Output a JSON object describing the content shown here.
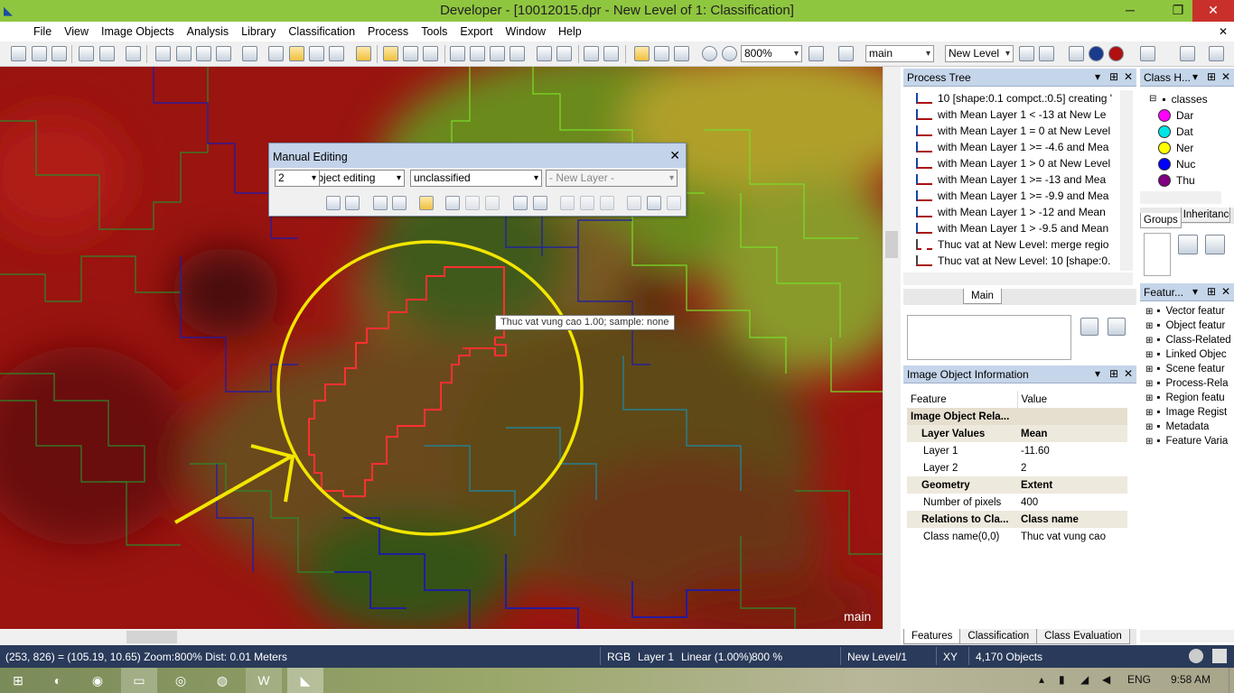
{
  "window": {
    "title": "Developer - [10012015.dpr - New Level of 1: Classification]",
    "minimize": "─",
    "restore": "❐",
    "close": "✕"
  },
  "menu": [
    "File",
    "View",
    "Image Objects",
    "Analysis",
    "Library",
    "Classification",
    "Process",
    "Tools",
    "Export",
    "Window",
    "Help"
  ],
  "toolbar": {
    "zoom": "800%",
    "view_combo": "main",
    "level_combo": "New Level"
  },
  "view": {
    "label": "main"
  },
  "manual_editing": {
    "title": "Manual Editing",
    "close": "✕",
    "mode": "Image object editing",
    "class": "unclassified",
    "layer": "- New Layer -",
    "brush": "2"
  },
  "tooltip": "Thuc vat vung cao 1.00;  sample: none",
  "process_tree": {
    "title": "Process Tree",
    "items": [
      "10 [shape:0.1 compct.:0.5] creating '",
      "with Mean Layer 1 < -13  at  New Le",
      "with Mean Layer 1 = 0  at  New Level",
      "with Mean Layer 1 >= -4.6  and Mea",
      "with Mean Layer 1 > 0  at  New Level",
      "with Mean Layer 1 >= -13  and Mea",
      "with Mean Layer 1 >= -9.9  and Mea",
      "with Mean Layer 1 > -12  and Mean",
      "with Mean Layer 1 > -9.5  and Mean",
      "Thuc vat at  New Level: merge regio",
      "Thuc vat at  New Level: 10 [shape:0."
    ],
    "tab": "Main"
  },
  "class_hierarchy": {
    "title": "Class H...",
    "root": "classes",
    "classes": [
      {
        "label": "Dar",
        "color": "#ff00ff"
      },
      {
        "label": "Dat",
        "color": "#00e5e5"
      },
      {
        "label": "Ner",
        "color": "#ffff00"
      },
      {
        "label": "Nuc",
        "color": "#0000ff"
      },
      {
        "label": "Thu",
        "color": "#800080"
      }
    ],
    "tabs": [
      "Groups",
      "Inheritance"
    ]
  },
  "feature_view": {
    "title": "Featur...",
    "items": [
      "Vector featur",
      "Object featur",
      "Class-Related",
      "Linked Objec",
      "Scene featur",
      "Process-Rela",
      "Region featu",
      "Image Regist",
      "Metadata",
      "Feature Varia"
    ]
  },
  "image_object_info": {
    "title": "Image Object Information",
    "col_feature": "Feature",
    "col_value": "Value",
    "section": "Image Object Rela...",
    "groups": [
      {
        "name": "Layer Values",
        "header_value": "Mean",
        "rows": [
          {
            "k": "Layer 1",
            "v": "-11.60"
          },
          {
            "k": "Layer 2",
            "v": "2"
          }
        ]
      },
      {
        "name": "Geometry",
        "header_value": "Extent",
        "rows": [
          {
            "k": "Number of pixels",
            "v": "400"
          }
        ]
      },
      {
        "name": "Relations to Cla...",
        "header_value": "Class name",
        "rows": [
          {
            "k": "Class name(0,0)",
            "v": "Thuc vat vung cao"
          }
        ]
      }
    ],
    "tabs": [
      "Features",
      "Classification",
      "Class Evaluation"
    ]
  },
  "status": {
    "coords": "(253, 826) = (105.19, 10.65)  Zoom:800%  Dist: 0.01 Meters",
    "mode": "RGB",
    "layer": "Layer 1",
    "stretch": "Linear (1.00%)",
    "zoom": "800 %",
    "level": "New Level/1",
    "xy": "XY",
    "objects": "4,170 Objects"
  },
  "taskbar": {
    "lang": "ENG",
    "time": "9:58 AM"
  }
}
